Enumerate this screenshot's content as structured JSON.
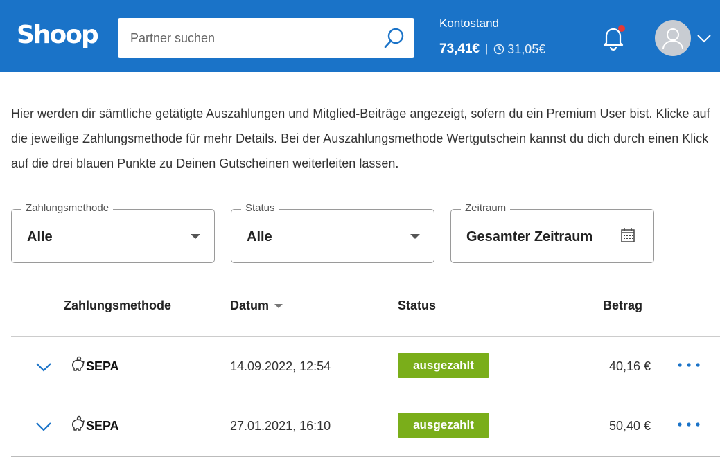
{
  "header": {
    "logo": "Shoop",
    "search_placeholder": "Partner suchen",
    "balance_label": "Kontostand",
    "balance_main": "73,41€",
    "balance_separator": "|",
    "balance_pending": "31,05€"
  },
  "intro": "Hier werden dir sämtliche getätigte Auszahlungen und Mitglied-Beiträge angezeigt, sofern du ein Premium User bist. Klicke auf die jeweilige Zahlungsmethode für mehr Details. Bei der Auszahlungsmethode Wertgutschein kannst du dich durch einen Klick auf die drei blauen Punkte zu Deinen Gutscheinen weiterleiten lassen.",
  "filters": {
    "method": {
      "label": "Zahlungsmethode",
      "value": "Alle"
    },
    "status": {
      "label": "Status",
      "value": "Alle"
    },
    "period": {
      "label": "Zeitraum",
      "value": "Gesamter Zeitraum"
    }
  },
  "table": {
    "headers": {
      "method": "Zahlungsmethode",
      "date": "Datum",
      "status": "Status",
      "amount": "Betrag"
    },
    "rows": [
      {
        "method": "SEPA",
        "date": "14.09.2022, 12:54",
        "status": "ausgezahlt",
        "amount": "40,16 €"
      },
      {
        "method": "SEPA",
        "date": "27.01.2021, 16:10",
        "status": "ausgezahlt",
        "amount": "50,40 €"
      }
    ]
  },
  "colors": {
    "header_bg": "#1a73c8",
    "status_badge": "#7aae1a",
    "accent_blue": "#1a73c8",
    "notification_dot": "#e53935"
  },
  "icons": [
    "search-icon",
    "clock-icon",
    "bell-icon",
    "avatar-icon",
    "chevron-down-icon",
    "calendar-icon",
    "piggy-bank-icon",
    "more-dots-icon"
  ]
}
